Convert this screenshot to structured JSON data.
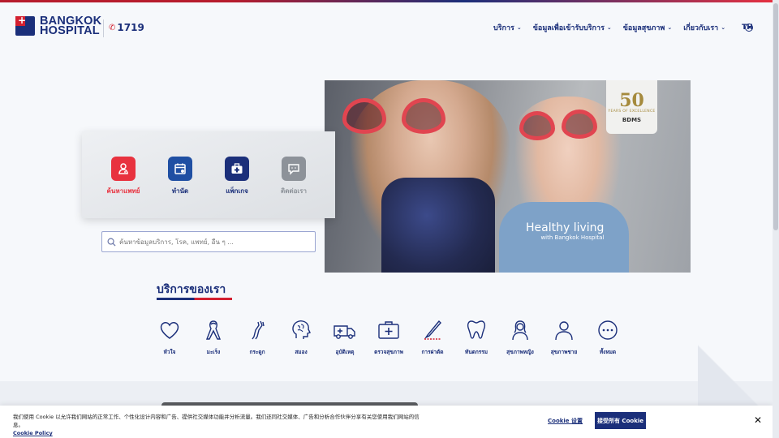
{
  "header": {
    "logo_line1": "BANGKOK",
    "logo_line2": "HOSPITAL",
    "hotline": "1719",
    "nav": [
      {
        "label": "บริการ"
      },
      {
        "label": "ข้อมูลเพื่อเข้ารับบริการ"
      },
      {
        "label": "ข้อมูลสุขภาพ"
      },
      {
        "label": "เกี่ยวกับเรา"
      }
    ],
    "lang": "TH"
  },
  "hero": {
    "badge_number": "50",
    "badge_years": "YEARS OF EXCELLENCE",
    "badge_brand": "BDMS",
    "caption_main": "Healthy living",
    "caption_sub": "with Bangkok Hospital"
  },
  "quick_actions": [
    {
      "label": "ค้นหาแพทย์",
      "icon": "doctor-icon",
      "color": "#e8323f"
    },
    {
      "label": "ทำนัด",
      "icon": "calendar-icon",
      "color": "#1f4fa3"
    },
    {
      "label": "แพ็กเกจ",
      "icon": "medical-bag-icon",
      "color": "#1b2f7a"
    },
    {
      "label": "ติดต่อเรา",
      "icon": "chat-icon",
      "color": "#8d9299"
    }
  ],
  "search": {
    "placeholder": "ค้นหาข้อมูลบริการ, โรค, แพทย์, อื่น ๆ ..."
  },
  "services": {
    "title": "บริการของเรา",
    "items": [
      {
        "label": "หัวใจ",
        "icon": "heart-icon"
      },
      {
        "label": "มะเร็ง",
        "icon": "ribbon-icon"
      },
      {
        "label": "กระดูก",
        "icon": "bone-icon"
      },
      {
        "label": "สมอง",
        "icon": "brain-icon"
      },
      {
        "label": "อุบัติเหตุ",
        "icon": "ambulance-icon"
      },
      {
        "label": "ตรวจสุขภาพ",
        "icon": "first-aid-kit-icon"
      },
      {
        "label": "การผ่าตัด",
        "icon": "scalpel-icon"
      },
      {
        "label": "ทันตกรรม",
        "icon": "tooth-icon"
      },
      {
        "label": "สุขภาพหญิง",
        "icon": "woman-icon"
      },
      {
        "label": "สุขภาพชาย",
        "icon": "man-icon"
      },
      {
        "label": "ทั้งหมด",
        "icon": "more-icon"
      }
    ]
  },
  "cookie_banner": {
    "text": "我们使用 Cookie 以允许我们网站的正常工作、个性化设计内容和广告、提供社交媒体功能并分析流量。我们还同社交媒体、广告和分析合作伙伴分享有关您使用我们网站的信息。",
    "policy_link": "Cookie Policy",
    "settings_label": "Cookie 设置",
    "accept_label": "接受所有 Cookie"
  },
  "colors": {
    "brand_navy": "#1b2f7a",
    "brand_red": "#d32030"
  }
}
